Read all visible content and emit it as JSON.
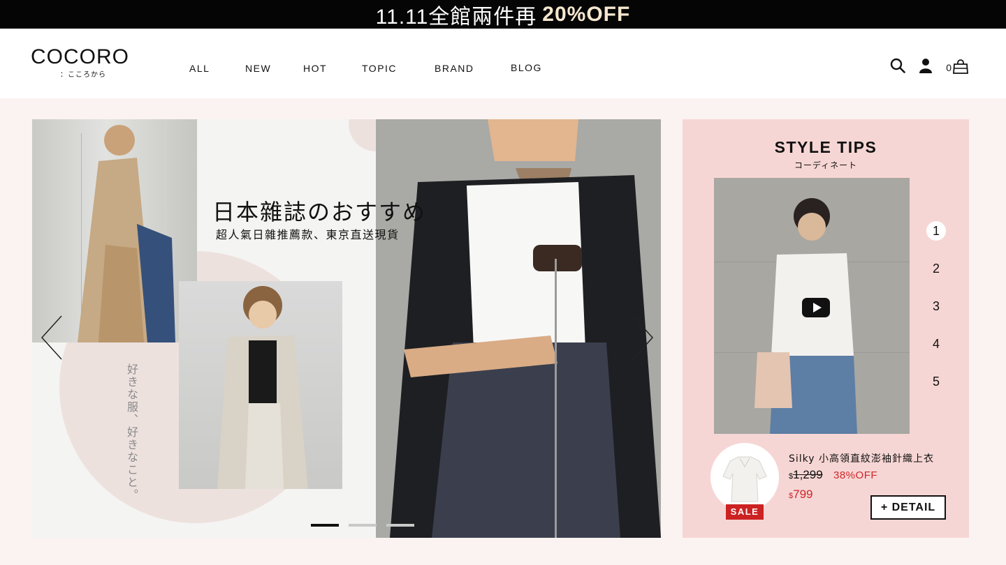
{
  "promo": {
    "prefix": "11.11全館兩件再",
    "highlight": "20%OFF"
  },
  "logo": {
    "main": "COCORO",
    "sub": "：こころから"
  },
  "nav": [
    "ALL",
    "NEW",
    "HOT",
    "TOPIC",
    "BRAND",
    "BLOG"
  ],
  "header_icons": [
    "search-icon",
    "user-icon",
    "cart-icon"
  ],
  "cart": {
    "count": "0"
  },
  "hero": {
    "title": "日本雜誌のおすすめ",
    "subtitle": "超人氣日雜推薦款、東京直送現貨",
    "vertical_text": "好きな服、好きなこと。",
    "slides": 3,
    "active_slide": 1
  },
  "tips": {
    "title": "STYLE TIPS",
    "subtitle": "コーディネート",
    "numbers": [
      "1",
      "2",
      "3",
      "4",
      "5"
    ],
    "active_number": "1",
    "product": {
      "name": "Silky 小高領直紋澎袖針織上衣",
      "currency": "$",
      "old_price": "1,299",
      "discount": "38%OFF",
      "new_price": "799",
      "badge": "SALE",
      "detail_label": "+ DETAIL"
    }
  },
  "colors": {
    "accent_red": "#d0252a",
    "tips_bg": "#f6d6d4",
    "promo_bg": "#050505",
    "highlight": "#f5e7cf"
  }
}
